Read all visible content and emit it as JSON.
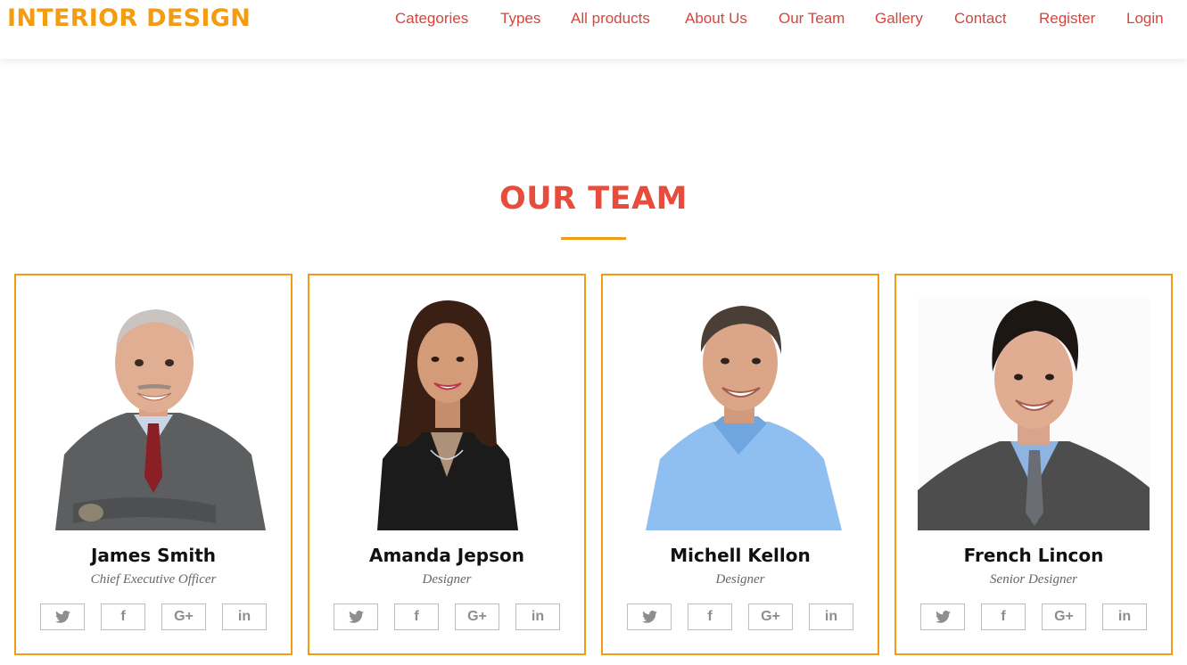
{
  "brand": "INTERIOR DESIGN",
  "nav": [
    "Categories",
    "Types",
    "All products",
    "About Us",
    "Our Team",
    "Gallery",
    "Contact",
    "Register",
    "Login"
  ],
  "section": {
    "title": "OUR TEAM"
  },
  "team": [
    {
      "name": "James Smith",
      "role": "Chief Executive Officer",
      "photo": "man-grey-suit-photo"
    },
    {
      "name": "Amanda Jepson",
      "role": "Designer",
      "photo": "woman-black-blazer-photo"
    },
    {
      "name": "Michell Kellon",
      "role": "Designer",
      "photo": "man-blue-shirt-photo"
    },
    {
      "name": "French Lincon",
      "role": "Senior Designer",
      "photo": "young-man-suit-photo"
    }
  ],
  "social_icons": [
    "twitter-icon",
    "facebook-icon",
    "google-plus-icon",
    "linkedin-icon"
  ],
  "social_labels": {
    "google": "G+",
    "linkedin": "in",
    "facebook": "f"
  },
  "colors": {
    "brand": "#f39c12",
    "nav": "#d9443a",
    "title": "#e74c3c",
    "card_border": "#f39c12"
  }
}
